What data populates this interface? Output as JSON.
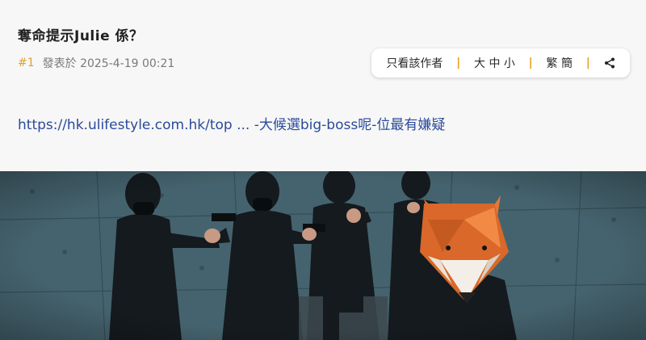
{
  "post": {
    "title": "奪命提示Julie 係？",
    "number": "#1",
    "posted_label": "發表於 2025-4-19 00:21",
    "link_text": "https://hk.ulifestyle.com.hk/top  ...  -大候選big-boss呢-位最有嫌疑"
  },
  "toolbar": {
    "author_only": "只看該作者",
    "font_size": "大 中 小",
    "script": "繁 簡",
    "separator": "|",
    "share_icon": "share-icon"
  },
  "image": {
    "description_icon": "photo-scene"
  },
  "colors": {
    "accent": "#e8a020",
    "link": "#2a4a9c"
  }
}
